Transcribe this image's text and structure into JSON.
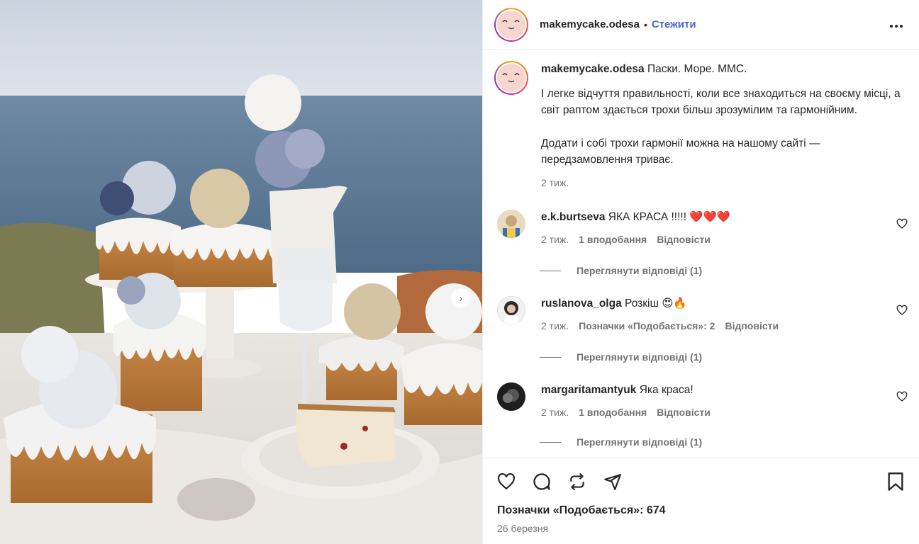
{
  "post": {
    "username": "makemycake.odesa",
    "separator": "•",
    "follow_label": "Стежити",
    "more_label": "•••"
  },
  "caption": {
    "username": "makemycake.odesa",
    "headline": "Паски. Море. ММС.",
    "paragraph_1": "І легке відчуття правильності, коли все знаходиться на своєму місці, а світ раптом здається трохи більш зрозумілим та гармонійним.",
    "paragraph_2": "Додати і собі трохи гармонії можна на нашому сайті — передзамовлення триває.",
    "time": "2 тиж."
  },
  "comments": [
    {
      "username": "e.k.burtseva",
      "text": "ЯКА КРАСА !!!!! ❤️❤️❤️",
      "time": "2 тиж.",
      "likes": "1 вподобання",
      "reply": "Відповісти",
      "view_replies": "Переглянути відповіді (1)",
      "avatar_color": "#d7c49a"
    },
    {
      "username": "ruslanova_olga",
      "text": "Розкіш 😍🔥",
      "time": "2 тиж.",
      "likes": "Позначки «Подобається»: 2",
      "reply": "Відповісти",
      "view_replies": "Переглянути відповіді (1)",
      "avatar_color": "#3b3b3b"
    },
    {
      "username": "margaritamantyuk",
      "text": "Яка краса!",
      "time": "2 тиж.",
      "likes": "1 вподобання",
      "reply": "Відповісти",
      "view_replies": "Переглянути відповіді (1)",
      "avatar_color": "#2a2a2a"
    }
  ],
  "footer": {
    "likes": "Позначки «Подобається»: 674",
    "date": "26 березня"
  },
  "colors": {
    "accent": "#4d67d6",
    "muted": "#737373",
    "text": "#262626"
  }
}
